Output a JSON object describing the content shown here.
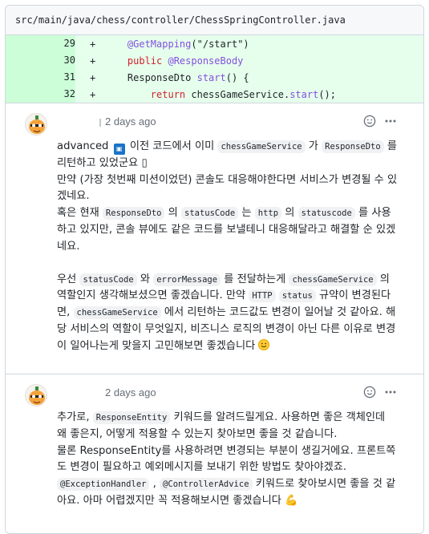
{
  "file": {
    "path": "src/main/java/chess/controller/ChessSpringController.java"
  },
  "diff": {
    "lines": [
      {
        "num": "29",
        "marker": "+",
        "indent": "    ",
        "parts": [
          {
            "t": "@GetMapping",
            "c": "an"
          },
          {
            "t": "(\"/start\")",
            "c": ""
          }
        ]
      },
      {
        "num": "30",
        "marker": "+",
        "indent": "    ",
        "parts": [
          {
            "t": "public ",
            "c": "kw"
          },
          {
            "t": "@ResponseBody",
            "c": "an"
          }
        ]
      },
      {
        "num": "31",
        "marker": "+",
        "indent": "    ",
        "parts": [
          {
            "t": "ResponseDto ",
            "c": ""
          },
          {
            "t": "start",
            "c": "fn"
          },
          {
            "t": "() {",
            "c": ""
          }
        ]
      },
      {
        "num": "32",
        "marker": "+",
        "indent": "        ",
        "parts": [
          {
            "t": "return ",
            "c": "kw"
          },
          {
            "t": "chessGameService.",
            "c": ""
          },
          {
            "t": "start",
            "c": "fn"
          },
          {
            "t": "();",
            "c": ""
          }
        ]
      }
    ]
  },
  "comments": [
    {
      "time": "2 days ago",
      "body": {
        "p1_a": "advanced ",
        "p1_b": " 이전 코드에서 이미 ",
        "p1_code1": "chessGameService",
        "p1_c": " 가 ",
        "p1_code2": "ResponseDto",
        "p1_d": " 를 리턴하고 있었군요 ",
        "p1_box": "▯",
        "p2": "만약 (가장 첫번째 미션이었던) 콘솔도 대응해야한다면 서비스가 변경될 수 있겠네요.",
        "p3_a": "혹은 현재 ",
        "p3_code1": "ResponseDto",
        "p3_b": " 의 ",
        "p3_code2": "statusCode",
        "p3_c": " 는 ",
        "p3_code3": "http",
        "p3_d": " 의 ",
        "p3_code4": "statuscode",
        "p3_e": " 를 사용하고 있지만, 콘솔 뷰에도 같은 코드를 보낼테니 대응해달라고 해결할 순 있겠네요.",
        "p4_a": "우선 ",
        "p4_code1": "statusCode",
        "p4_b": " 와 ",
        "p4_code2": "errorMessage",
        "p4_c": " 를 전달하는게 ",
        "p4_code3": "chessGameService",
        "p4_d": " 의 역할인지 생각해보셨으면 좋겠습니다. 만약 ",
        "p4_code4": "HTTP",
        "p4_e": " ",
        "p4_code5": "status",
        "p4_f": " 규약이 변경된다면, ",
        "p4_code6": "chessGameService",
        "p4_g": " 에서 리턴하는 코드값도 변경이 일어날 것 같아요. 해당 서비스의 역할이 무엇일지, 비즈니스 로직의 변경이 아닌 다른 이유로 변경이 일어나는게 맞을지 고민해보면 좋겠습니다 "
      }
    },
    {
      "time": "2 days ago",
      "body": {
        "p1_a": "추가로, ",
        "p1_code1": "ResponseEntity",
        "p1_b": " 키워드를 알려드릴게요. 사용하면 좋은 객체인데 왜 좋은지, 어떻게 적용할 수 있는지 찾아보면 좋을 것 같습니다.",
        "p2": "물론 ResponseEntity를 사용하려면 변경되는 부분이 생길거에요. 프론트쪽도 변경이 필요하고 예외메시지를 보내기 위한 방법도 찾아야겠죠.",
        "p3_code1": "@ExceptionHandler",
        "p3_a": " , ",
        "p3_code2": "@ControllerAdvice",
        "p3_b": " 키워드로 찾아보시면 좋을 것 같아요. 아마 어렵겠지만 꼭 적용해보시면 좋겠습니다 ",
        "p3_emoji": "💪"
      }
    }
  ],
  "icons": {
    "smiley": "smiley-icon",
    "kebab": "kebab-horizontal-icon",
    "badge": "badge-icon"
  }
}
